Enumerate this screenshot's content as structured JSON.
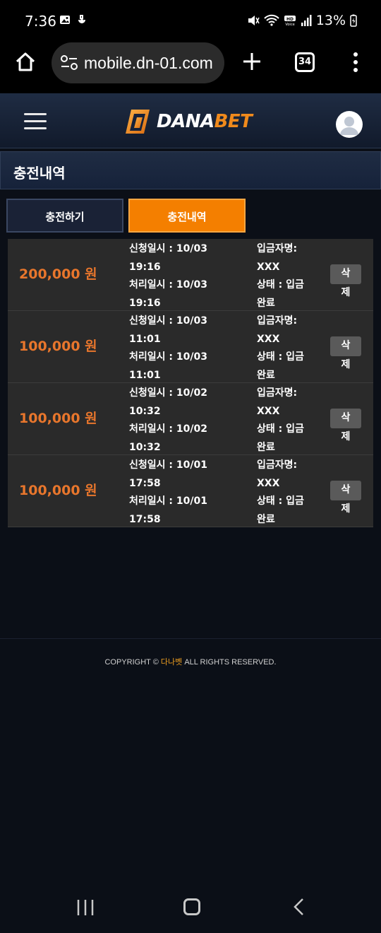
{
  "status_bar": {
    "time": "7:36",
    "battery": "13%",
    "icons": [
      "gallery-icon",
      "notification-icon",
      "mute-icon",
      "wifi-icon",
      "hd-voice-icon",
      "signal-icon",
      "battery-charging-icon"
    ]
  },
  "browser": {
    "url": "mobile.dn-01.com",
    "tab_count": "34"
  },
  "header": {
    "logo_white": "DANA",
    "logo_orange": "BET",
    "brand_color": "#f08a1c"
  },
  "page": {
    "title": "충전내역"
  },
  "tabs": {
    "charge": "충전하기",
    "history": "충전내역",
    "active_color": "#f47f00"
  },
  "history": [
    {
      "amount": "200,000 원",
      "request_line1": "신청일시 : 10/03",
      "request_line2": "19:16",
      "process_line1": "처리일시 : 10/03",
      "process_line2": "19:16",
      "depositor_label": "입금자명:",
      "depositor": "XXX",
      "status_line1": "상태 : 입금",
      "status_line2": "완료",
      "delete_line1": "삭",
      "delete_line2": "제"
    },
    {
      "amount": "100,000 원",
      "request_line1": "신청일시 : 10/03",
      "request_line2": "11:01",
      "process_line1": "처리일시 : 10/03",
      "process_line2": "11:01",
      "depositor_label": "입금자명:",
      "depositor": "XXX",
      "status_line1": "상태 : 입금",
      "status_line2": "완료",
      "delete_line1": "삭",
      "delete_line2": "제"
    },
    {
      "amount": "100,000 원",
      "request_line1": "신청일시 : 10/02",
      "request_line2": "10:32",
      "process_line1": "처리일시 : 10/02",
      "process_line2": "10:32",
      "depositor_label": "입금자명:",
      "depositor": "XXX",
      "status_line1": "상태 : 입금",
      "status_line2": "완료",
      "delete_line1": "삭",
      "delete_line2": "제"
    },
    {
      "amount": "100,000 원",
      "request_line1": "신청일시 : 10/01",
      "request_line2": "17:58",
      "process_line1": "처리일시 : 10/01",
      "process_line2": "17:58",
      "depositor_label": "입금자명:",
      "depositor": "XXX",
      "status_line1": "상태 : 입금",
      "status_line2": "완료",
      "delete_line1": "삭",
      "delete_line2": "제"
    }
  ],
  "footer": {
    "prefix": "COPYRIGHT © ",
    "brand": "다나벳",
    "suffix": " ALL RIGHTS RESERVED."
  }
}
